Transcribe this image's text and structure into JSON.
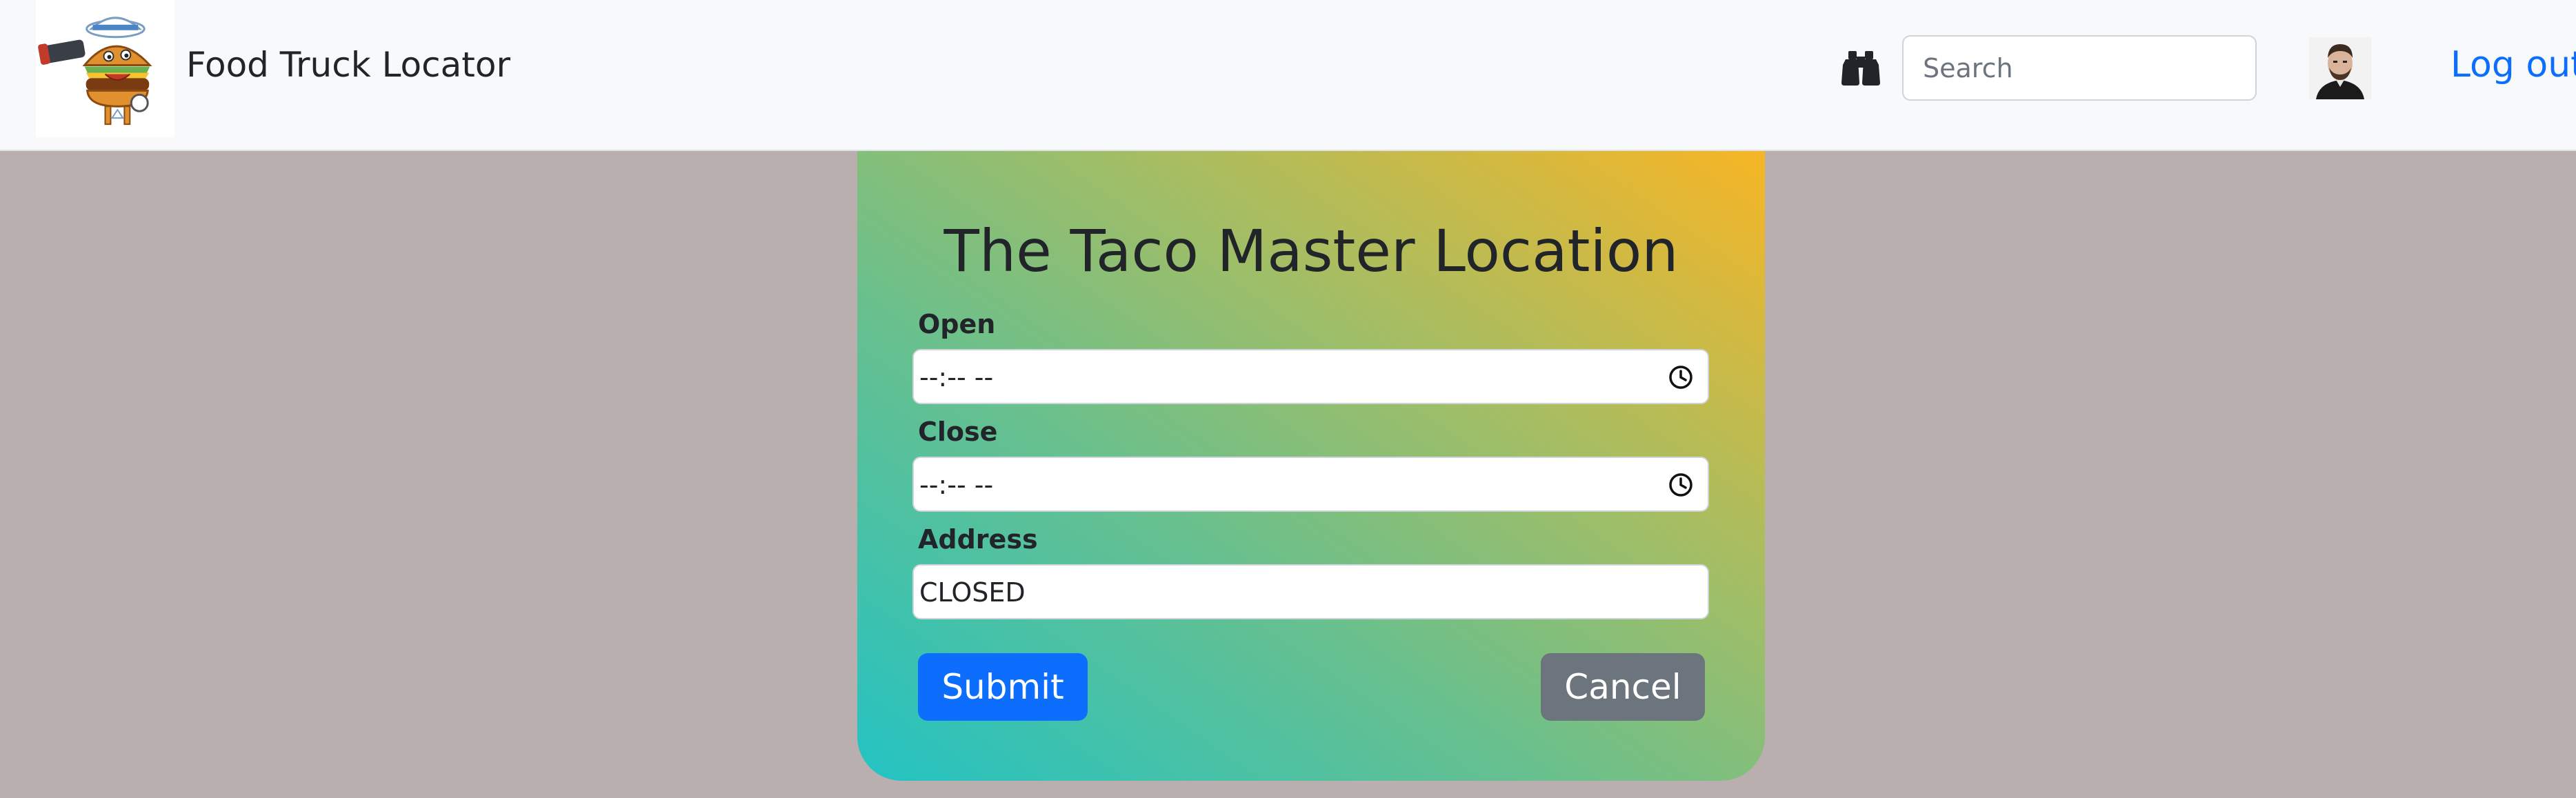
{
  "navbar": {
    "brand_title": "Food Truck Locator",
    "logo_icon": "burger-sailor-logo",
    "search_icon": "binoculars-icon",
    "search_placeholder": "Search",
    "search_value": "",
    "avatar_icon": "user-avatar",
    "logout_label": "Log out",
    "logout_color": "#0d6efd"
  },
  "form": {
    "title": "The Taco Master Location",
    "open": {
      "label": "Open",
      "value": "--:-- --",
      "icon": "clock-icon"
    },
    "close": {
      "label": "Close",
      "value": "--:-- --",
      "icon": "clock-icon"
    },
    "address": {
      "label": "Address",
      "value": "CLOSED"
    },
    "submit_label": "Submit",
    "cancel_label": "Cancel",
    "colors": {
      "submit": "#0d6efd",
      "cancel": "#6c757d",
      "gradient_start": "#23c3c3",
      "gradient_end": "#f7b525"
    }
  },
  "page": {
    "background": "#b9afaf"
  }
}
